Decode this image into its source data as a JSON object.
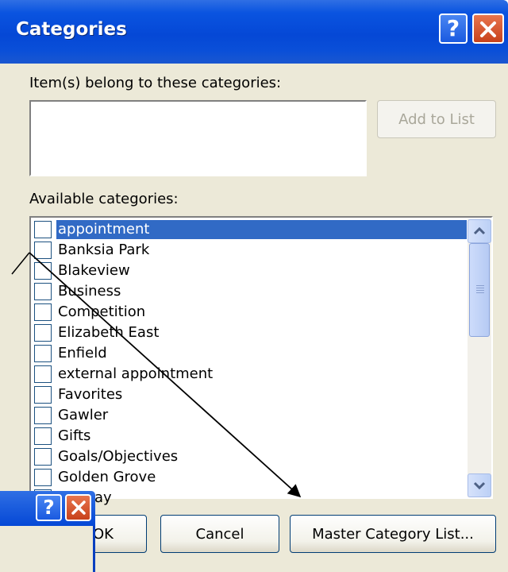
{
  "dialog": {
    "title": "Categories",
    "help_glyph": "?",
    "belong_label": "Item(s) belong to these categories:",
    "belong_value": "",
    "add_to_list_label": "Add to List",
    "available_label": "Available categories:",
    "categories": [
      {
        "label": "appointment",
        "checked": false,
        "selected": true
      },
      {
        "label": "Banksia Park",
        "checked": false,
        "selected": false
      },
      {
        "label": "Blakeview",
        "checked": false,
        "selected": false
      },
      {
        "label": "Business",
        "checked": false,
        "selected": false
      },
      {
        "label": "Competition",
        "checked": false,
        "selected": false
      },
      {
        "label": "Elizabeth East",
        "checked": false,
        "selected": false
      },
      {
        "label": "Enfield",
        "checked": false,
        "selected": false
      },
      {
        "label": "external appointment",
        "checked": false,
        "selected": false
      },
      {
        "label": "Favorites",
        "checked": false,
        "selected": false
      },
      {
        "label": "Gawler",
        "checked": false,
        "selected": false
      },
      {
        "label": "Gifts",
        "checked": false,
        "selected": false
      },
      {
        "label": "Goals/Objectives",
        "checked": false,
        "selected": false
      },
      {
        "label": "Golden Grove",
        "checked": false,
        "selected": false
      },
      {
        "label": "Holiday",
        "checked": false,
        "selected": false
      }
    ],
    "ok_label": "OK",
    "cancel_label": "Cancel",
    "master_label": "Master Category List..."
  },
  "child_dialog": {
    "help_glyph": "?"
  },
  "colors": {
    "titlebar": "#0a54e0",
    "selection": "#316ac5",
    "dialog_face": "#ece9d8",
    "close_button": "#c8421c"
  },
  "icons": [
    "help-icon",
    "close-icon",
    "scroll-up-icon",
    "scroll-down-icon",
    "arrow-annotation"
  ]
}
